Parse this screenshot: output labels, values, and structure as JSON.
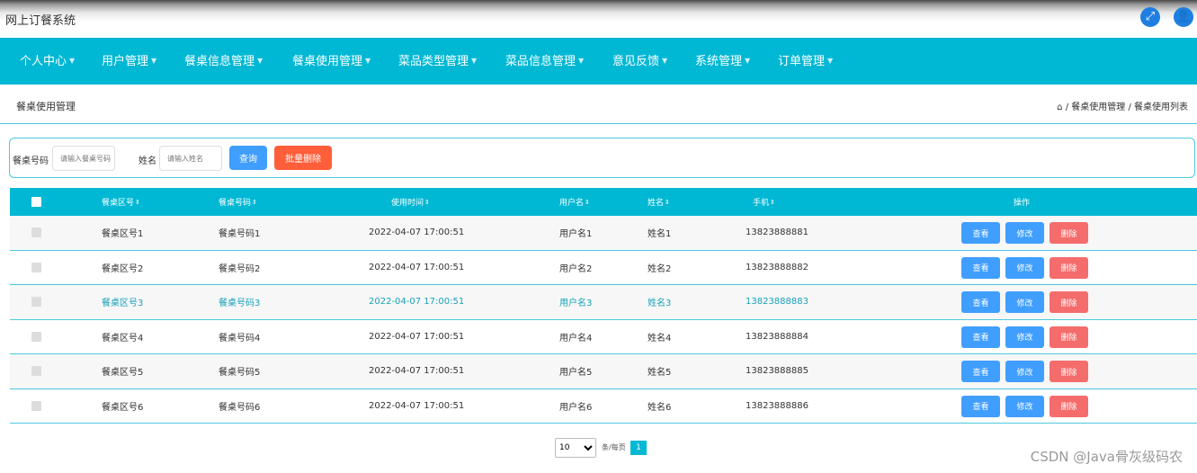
{
  "app": {
    "title": "网上订餐系统"
  },
  "topbar": {
    "fullscreen_icon": "expand-icon",
    "user_icon": "user-icon"
  },
  "nav": {
    "items": [
      {
        "label": "个人中心"
      },
      {
        "label": "用户管理"
      },
      {
        "label": "餐桌信息管理"
      },
      {
        "label": "餐桌使用管理"
      },
      {
        "label": "菜品类型管理"
      },
      {
        "label": "菜品信息管理"
      },
      {
        "label": "意见反馈"
      },
      {
        "label": "系统管理"
      },
      {
        "label": "订单管理"
      }
    ]
  },
  "page": {
    "title": "餐桌使用管理",
    "breadcrumb": {
      "home_icon": "home-icon",
      "level1": "餐桌使用管理",
      "separator": "/",
      "level2": "餐桌使用列表"
    }
  },
  "search": {
    "table_no_label": "餐桌号码",
    "table_no_placeholder": "请输入餐桌号码",
    "name_label": "姓名",
    "name_placeholder": "请输入姓名",
    "query_button": "查询",
    "batch_delete_button": "批量删除"
  },
  "table": {
    "headers": {
      "area": "餐桌区号",
      "number": "餐桌号码",
      "time": "使用时间",
      "username": "用户名",
      "name": "姓名",
      "phone": "手机",
      "actions": "操作",
      "sort_glyph": "⇕"
    },
    "action_labels": {
      "view": "查看",
      "edit": "修改",
      "delete": "删除"
    },
    "rows": [
      {
        "area": "餐桌区号1",
        "number": "餐桌号码1",
        "time": "2022-04-07 17:00:51",
        "username": "用户名1",
        "name": "姓名1",
        "phone": "13823888881"
      },
      {
        "area": "餐桌区号2",
        "number": "餐桌号码2",
        "time": "2022-04-07 17:00:51",
        "username": "用户名2",
        "name": "姓名2",
        "phone": "13823888882"
      },
      {
        "area": "餐桌区号3",
        "number": "餐桌号码3",
        "time": "2022-04-07 17:00:51",
        "username": "用户名3",
        "name": "姓名3",
        "phone": "13823888883"
      },
      {
        "area": "餐桌区号4",
        "number": "餐桌号码4",
        "time": "2022-04-07 17:00:51",
        "username": "用户名4",
        "name": "姓名4",
        "phone": "13823888884"
      },
      {
        "area": "餐桌区号5",
        "number": "餐桌号码5",
        "time": "2022-04-07 17:00:51",
        "username": "用户名5",
        "name": "姓名5",
        "phone": "13823888885"
      },
      {
        "area": "餐桌区号6",
        "number": "餐桌号码6",
        "time": "2022-04-07 17:00:51",
        "username": "用户名6",
        "name": "姓名6",
        "phone": "13823888886"
      }
    ]
  },
  "pagination": {
    "page_size": "10",
    "page_size_options": [
      "10"
    ],
    "per_page_label": "条/每页",
    "current_page": "1"
  },
  "watermark": "CSDN @Java骨灰级码农",
  "colors": {
    "primary": "#00b8d4",
    "button_blue": "#409eff",
    "button_red": "#f56c6c",
    "batch_delete": "#ff5e3a"
  }
}
